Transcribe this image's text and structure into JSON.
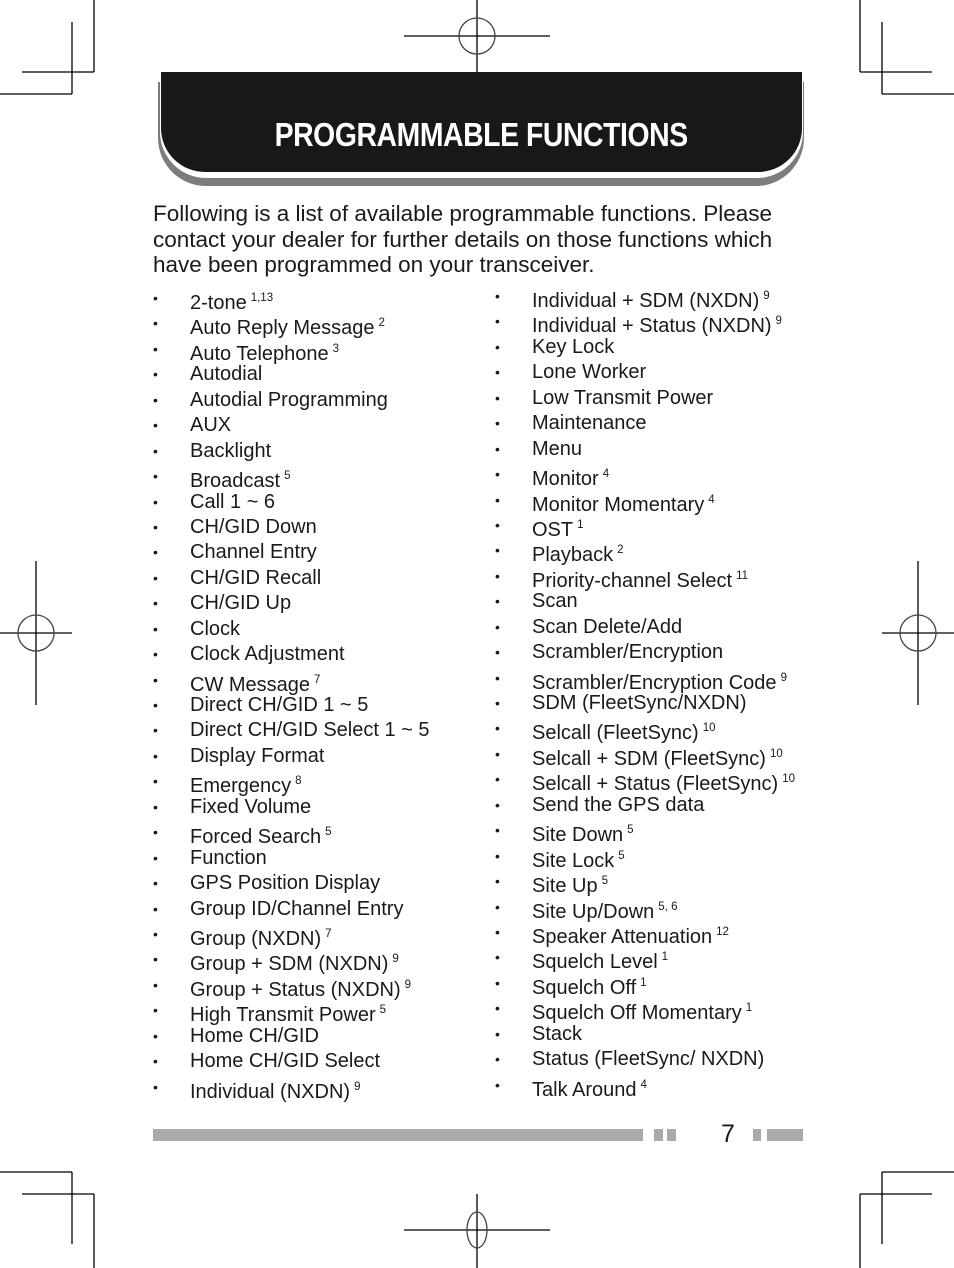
{
  "header": {
    "title": "PROGRAMMABLE FUNCTIONS"
  },
  "intro": "Following is a list of available programmable functions.  Please contact your dealer for further details on those functions which have been programmed on your transceiver.",
  "bullet_glyph": "•",
  "left_column": [
    {
      "label": "2-tone",
      "note": "1,13"
    },
    {
      "label": "Auto Reply Message",
      "note": "2"
    },
    {
      "label": "Auto Telephone",
      "note": "3"
    },
    {
      "label": "Autodial",
      "note": ""
    },
    {
      "label": "Autodial Programming",
      "note": ""
    },
    {
      "label": "AUX",
      "note": ""
    },
    {
      "label": "Backlight",
      "note": ""
    },
    {
      "label": "Broadcast",
      "note": "5"
    },
    {
      "label": "Call 1 ~ 6",
      "note": ""
    },
    {
      "label": "CH/GID Down",
      "note": ""
    },
    {
      "label": "Channel Entry",
      "note": ""
    },
    {
      "label": "CH/GID Recall",
      "note": ""
    },
    {
      "label": "CH/GID Up",
      "note": ""
    },
    {
      "label": "Clock",
      "note": ""
    },
    {
      "label": "Clock Adjustment",
      "note": ""
    },
    {
      "label": "CW Message",
      "note": "7"
    },
    {
      "label": "Direct CH/GID 1 ~ 5",
      "note": ""
    },
    {
      "label": "Direct CH/GID Select 1 ~ 5",
      "note": ""
    },
    {
      "label": "Display Format",
      "note": ""
    },
    {
      "label": "Emergency",
      "note": "8"
    },
    {
      "label": "Fixed Volume",
      "note": ""
    },
    {
      "label": "Forced Search",
      "note": "5"
    },
    {
      "label": "Function",
      "note": ""
    },
    {
      "label": "GPS Position Display",
      "note": ""
    },
    {
      "label": "Group ID/Channel Entry",
      "note": ""
    },
    {
      "label": "Group (NXDN)",
      "note": "7"
    },
    {
      "label": "Group + SDM (NXDN)",
      "note": "9"
    },
    {
      "label": "Group + Status (NXDN)",
      "note": "9"
    },
    {
      "label": "High Transmit Power",
      "note": "5"
    },
    {
      "label": "Home CH/GID",
      "note": ""
    },
    {
      "label": "Home CH/GID Select",
      "note": ""
    },
    {
      "label": "Individual (NXDN)",
      "note": "9"
    }
  ],
  "right_column": [
    {
      "label": "Individual + SDM (NXDN)",
      "note": "9"
    },
    {
      "label": "Individual + Status (NXDN)",
      "note": "9"
    },
    {
      "label": "Key Lock",
      "note": ""
    },
    {
      "label": "Lone Worker",
      "note": ""
    },
    {
      "label": "Low Transmit Power",
      "note": ""
    },
    {
      "label": "Maintenance",
      "note": ""
    },
    {
      "label": "Menu",
      "note": ""
    },
    {
      "label": "Monitor",
      "note": "4"
    },
    {
      "label": "Monitor Momentary",
      "note": "4"
    },
    {
      "label": "OST",
      "note": "1"
    },
    {
      "label": "Playback",
      "note": "2"
    },
    {
      "label": "Priority-channel Select",
      "note": "11"
    },
    {
      "label": "Scan",
      "note": ""
    },
    {
      "label": "Scan Delete/Add",
      "note": ""
    },
    {
      "label": "Scrambler/Encryption",
      "note": ""
    },
    {
      "label": "Scrambler/Encryption Code",
      "note": "9"
    },
    {
      "label": "SDM (FleetSync/NXDN)",
      "note": ""
    },
    {
      "label": "Selcall (FleetSync)",
      "note": "10"
    },
    {
      "label": "Selcall + SDM (FleetSync)",
      "note": "10"
    },
    {
      "label": "Selcall + Status (FleetSync)",
      "note": "10"
    },
    {
      "label": "Send the GPS data",
      "note": ""
    },
    {
      "label": "Site Down",
      "note": "5"
    },
    {
      "label": "Site Lock",
      "note": "5"
    },
    {
      "label": "Site Up",
      "note": "5"
    },
    {
      "label": "Site Up/Down",
      "note": "5, 6"
    },
    {
      "label": "Speaker Attenuation",
      "note": "12"
    },
    {
      "label": "Squelch Level",
      "note": "1"
    },
    {
      "label": "Squelch Off",
      "note": "1"
    },
    {
      "label": "Squelch Off Momentary",
      "note": "1"
    },
    {
      "label": "Stack",
      "note": ""
    },
    {
      "label": "Status (FleetSync/ NXDN)",
      "note": ""
    },
    {
      "label": "Talk Around",
      "note": "4"
    }
  ],
  "footer": {
    "page_number": "7"
  },
  "colors": {
    "header_bg": "#181818",
    "header_shadow": "#7d7d7d",
    "footer_bar": "#aaaaaa",
    "text": "#1a1a1a"
  }
}
